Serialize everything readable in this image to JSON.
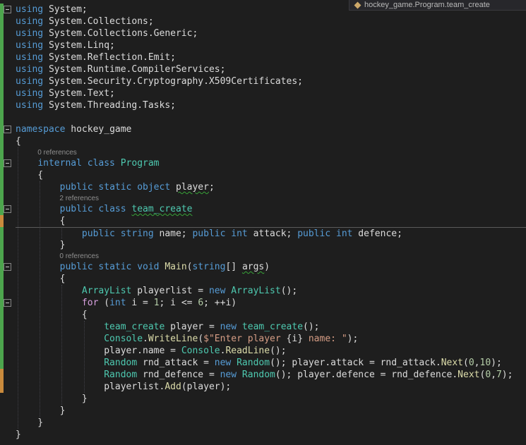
{
  "scope_indicator": {
    "icon": "class-icon",
    "text": "hockey_game.Program.team_create"
  },
  "colors": {
    "background": "#1E1E1E",
    "plain": "#DCDCDC",
    "keyword": "#569CD6",
    "control": "#D8A0DF",
    "type": "#4EC9B0",
    "method": "#DCDCAA",
    "string": "#D69D85",
    "number": "#B5CEA8",
    "codelens": "#8F8F8F",
    "squiggle": "#37A437",
    "change_saved": "#4DA54D",
    "change_unsaved": "#C98A3C",
    "fold_border": "#858585",
    "guide": "#3F3F46",
    "currentline_border": "#5A5A5A",
    "breadcrumb_bg": "#27272B",
    "breadcrumb_text": "#B8B8B8",
    "breadcrumb_icon": "#CDA869"
  },
  "editor": {
    "rows": [
      {
        "k": "code",
        "fold": true,
        "tok": [
          [
            "kw",
            "using"
          ],
          [
            "pl",
            " System;"
          ]
        ]
      },
      {
        "k": "code",
        "tok": [
          [
            "kw",
            "using"
          ],
          [
            "pl",
            " System.Collections;"
          ]
        ]
      },
      {
        "k": "code",
        "tok": [
          [
            "kw",
            "using"
          ],
          [
            "pl",
            " System.Collections.Generic;"
          ]
        ]
      },
      {
        "k": "code",
        "tok": [
          [
            "kw",
            "using"
          ],
          [
            "pl",
            " System.Linq;"
          ]
        ]
      },
      {
        "k": "code",
        "tok": [
          [
            "kw",
            "using"
          ],
          [
            "pl",
            " System.Reflection.Emit;"
          ]
        ]
      },
      {
        "k": "code",
        "tok": [
          [
            "kw",
            "using"
          ],
          [
            "pl",
            " System.Runtime.CompilerServices;"
          ]
        ]
      },
      {
        "k": "code",
        "tok": [
          [
            "kw",
            "using"
          ],
          [
            "pl",
            " System.Security.Cryptography.X509Certificates;"
          ]
        ]
      },
      {
        "k": "code",
        "tok": [
          [
            "kw",
            "using"
          ],
          [
            "pl",
            " System.Text;"
          ]
        ]
      },
      {
        "k": "code",
        "tok": [
          [
            "kw",
            "using"
          ],
          [
            "pl",
            " System.Threading.Tasks;"
          ]
        ]
      },
      {
        "k": "blank"
      },
      {
        "k": "code",
        "fold": true,
        "tok": [
          [
            "kw",
            "namespace"
          ],
          [
            "pl",
            " hockey_game"
          ]
        ]
      },
      {
        "k": "code",
        "tok": [
          [
            "pl",
            "{"
          ]
        ]
      },
      {
        "k": "lens",
        "indent": 4,
        "text": "0 references"
      },
      {
        "k": "code",
        "fold": true,
        "tok": [
          [
            "pl",
            "    "
          ],
          [
            "kw",
            "internal class"
          ],
          [
            "pl",
            " "
          ],
          [
            "ty",
            "Program"
          ]
        ]
      },
      {
        "k": "code",
        "tok": [
          [
            "pl",
            "    {"
          ]
        ]
      },
      {
        "k": "code",
        "tok": [
          [
            "pl",
            "        "
          ],
          [
            "kw",
            "public static object"
          ],
          [
            "pl",
            " "
          ],
          [
            "pl",
            "player",
            "sq"
          ],
          [
            "pl",
            ";"
          ]
        ]
      },
      {
        "k": "lens",
        "indent": 8,
        "text": "2 references"
      },
      {
        "k": "code",
        "fold": true,
        "tok": [
          [
            "pl",
            "        "
          ],
          [
            "kw",
            "public class"
          ],
          [
            "pl",
            " "
          ],
          [
            "ty",
            "team_create",
            "sq"
          ]
        ]
      },
      {
        "k": "code",
        "tok": [
          [
            "pl",
            "        {"
          ]
        ]
      },
      {
        "k": "code",
        "hr": true,
        "tok": [
          [
            "pl",
            "            "
          ],
          [
            "kw",
            "public string"
          ],
          [
            "pl",
            " name; "
          ],
          [
            "kw",
            "public int"
          ],
          [
            "pl",
            " attack; "
          ],
          [
            "kw",
            "public int"
          ],
          [
            "pl",
            " defence;"
          ]
        ]
      },
      {
        "k": "code",
        "tok": [
          [
            "pl",
            "        }"
          ]
        ]
      },
      {
        "k": "lens",
        "indent": 8,
        "text": "0 references"
      },
      {
        "k": "code",
        "fold": true,
        "tok": [
          [
            "pl",
            "        "
          ],
          [
            "kw",
            "public static void"
          ],
          [
            "pl",
            " "
          ],
          [
            "me",
            "Main"
          ],
          [
            "pl",
            "("
          ],
          [
            "kw",
            "string"
          ],
          [
            "pl",
            "[] "
          ],
          [
            "pl",
            "args",
            "sq"
          ],
          [
            "pl",
            ")"
          ]
        ]
      },
      {
        "k": "code",
        "tok": [
          [
            "pl",
            "        {"
          ]
        ]
      },
      {
        "k": "code",
        "tok": [
          [
            "pl",
            "            "
          ],
          [
            "ty",
            "ArrayList"
          ],
          [
            "pl",
            " playerlist = "
          ],
          [
            "kw",
            "new"
          ],
          [
            "pl",
            " "
          ],
          [
            "ty",
            "ArrayList"
          ],
          [
            "pl",
            "();"
          ]
        ]
      },
      {
        "k": "code",
        "fold": true,
        "tok": [
          [
            "pl",
            "            "
          ],
          [
            "ct",
            "for"
          ],
          [
            "pl",
            " ("
          ],
          [
            "kw",
            "int"
          ],
          [
            "pl",
            " i = "
          ],
          [
            "nu",
            "1"
          ],
          [
            "pl",
            "; i <= "
          ],
          [
            "nu",
            "6"
          ],
          [
            "pl",
            "; ++i)"
          ]
        ]
      },
      {
        "k": "code",
        "tok": [
          [
            "pl",
            "            {"
          ]
        ]
      },
      {
        "k": "code",
        "tok": [
          [
            "pl",
            "                "
          ],
          [
            "ty",
            "team_create"
          ],
          [
            "pl",
            " player = "
          ],
          [
            "kw",
            "new"
          ],
          [
            "pl",
            " "
          ],
          [
            "ty",
            "team_create"
          ],
          [
            "pl",
            "();"
          ]
        ]
      },
      {
        "k": "code",
        "tok": [
          [
            "pl",
            "                "
          ],
          [
            "ty",
            "Console"
          ],
          [
            "pl",
            "."
          ],
          [
            "me",
            "WriteLine"
          ],
          [
            "pl",
            "("
          ],
          [
            "st",
            "$\"Enter player "
          ],
          [
            "pl",
            "{i}"
          ],
          [
            "st",
            " name: \""
          ],
          [
            "pl",
            ");"
          ]
        ]
      },
      {
        "k": "code",
        "tok": [
          [
            "pl",
            "                player.name = "
          ],
          [
            "ty",
            "Console"
          ],
          [
            "pl",
            "."
          ],
          [
            "me",
            "ReadLine"
          ],
          [
            "pl",
            "();"
          ]
        ]
      },
      {
        "k": "code",
        "tok": [
          [
            "pl",
            "                "
          ],
          [
            "ty",
            "Random"
          ],
          [
            "pl",
            " rnd_attack = "
          ],
          [
            "kw",
            "new"
          ],
          [
            "pl",
            " "
          ],
          [
            "ty",
            "Random"
          ],
          [
            "pl",
            "(); player.attack = rnd_attack."
          ],
          [
            "me",
            "Next"
          ],
          [
            "pl",
            "("
          ],
          [
            "nu",
            "0"
          ],
          [
            "pl",
            ","
          ],
          [
            "nu",
            "10"
          ],
          [
            "pl",
            ");"
          ]
        ]
      },
      {
        "k": "code",
        "tok": [
          [
            "pl",
            "                "
          ],
          [
            "ty",
            "Random"
          ],
          [
            "pl",
            " rnd_defence = "
          ],
          [
            "kw",
            "new"
          ],
          [
            "pl",
            " "
          ],
          [
            "ty",
            "Random"
          ],
          [
            "pl",
            "(); player.defence = rnd_defence."
          ],
          [
            "me",
            "Next"
          ],
          [
            "pl",
            "("
          ],
          [
            "nu",
            "0"
          ],
          [
            "pl",
            ","
          ],
          [
            "nu",
            "7"
          ],
          [
            "pl",
            ");"
          ]
        ]
      },
      {
        "k": "code",
        "tok": [
          [
            "pl",
            "                playerlist."
          ],
          [
            "me",
            "Add"
          ],
          [
            "pl",
            "(player);"
          ]
        ]
      },
      {
        "k": "code",
        "tok": [
          [
            "pl",
            "            }"
          ]
        ]
      },
      {
        "k": "code",
        "tok": [
          [
            "pl",
            "        }"
          ]
        ]
      },
      {
        "k": "code",
        "tok": [
          [
            "pl",
            "    }"
          ]
        ]
      },
      {
        "k": "code",
        "tok": [
          [
            "pl",
            "}"
          ]
        ]
      }
    ],
    "change_marks": [
      {
        "state": "saved",
        "rows": [
          0,
          17
        ]
      },
      {
        "state": "unsaved",
        "rows": [
          18,
          18
        ]
      },
      {
        "state": "saved",
        "rows": [
          19,
          30
        ]
      },
      {
        "state": "unsaved",
        "rows": [
          31,
          32
        ]
      }
    ],
    "indent_guides": [
      {
        "col": 0,
        "from": 12,
        "to": 36
      },
      {
        "col": 4,
        "from": 15,
        "to": 35
      },
      {
        "col": 8,
        "from": 19,
        "to": 20
      },
      {
        "col": 8,
        "from": 24,
        "to": 34
      },
      {
        "col": 12,
        "from": 27,
        "to": 33
      }
    ]
  }
}
